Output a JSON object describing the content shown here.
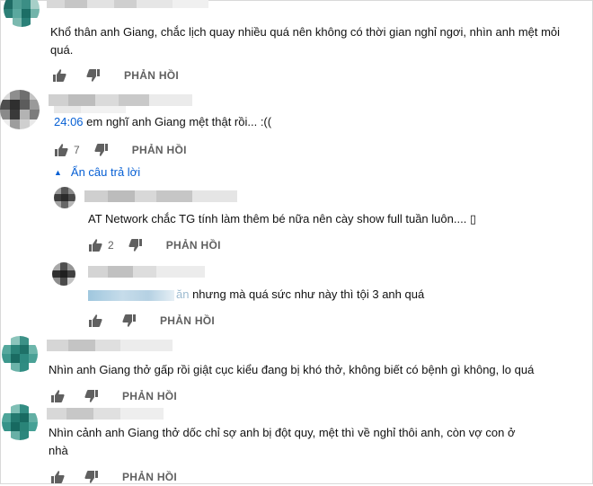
{
  "ui": {
    "reply_label": "PHẢN HỒI",
    "hide_replies_label": "Ẩn câu trả lời"
  },
  "comments": [
    {
      "text": "Khổ thân anh Giang, chắc lịch quay nhiều quá nên  không có thời gian nghỉ ngơi, nhìn anh mệt mỏi quá."
    },
    {
      "timestamp": "24:06",
      "text": " em nghĩ anh Giang mệt thật rồi... :((",
      "likes": "7"
    },
    {
      "text": "AT Network chắc TG tính làm thêm bé nữa nên cày show full tuần luôn.... ▯",
      "likes": "2"
    },
    {
      "mention_tail": "ăn",
      "text": " nhưng mà quá sức như này thì tội 3 anh quá"
    },
    {
      "text": "Nhìn anh Giang thở gấp rồi giật cục kiểu đang bị khó thở, không biết có bệnh gì không, lo quá"
    },
    {
      "text": "Nhìn cảnh anh Giang thở dốc chỉ sợ anh bị đột quy, mệt thì  về nghỉ thôi anh, còn vợ con ở nhà"
    }
  ],
  "colors": {
    "link_blue": "#065fd4",
    "secondary_text": "#606060",
    "teal_avatar": "#2a9d8f",
    "gray_avatar": "#5a5a5a"
  }
}
